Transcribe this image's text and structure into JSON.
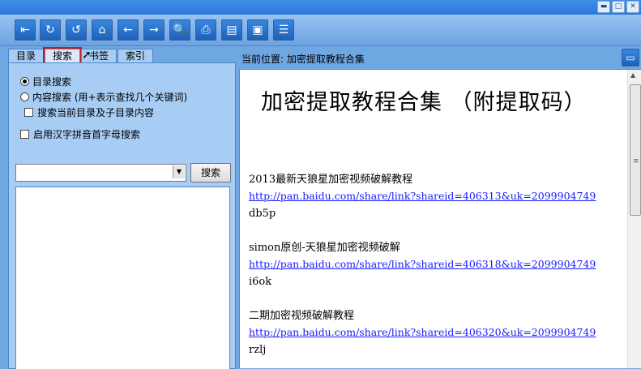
{
  "toolbar": {
    "buttons": [
      {
        "name": "hide-pane-icon",
        "glyph": "⇤"
      },
      {
        "name": "refresh-icon",
        "glyph": "↻"
      },
      {
        "name": "stop-icon",
        "glyph": "↺"
      },
      {
        "name": "home-icon",
        "glyph": "⌂"
      },
      {
        "name": "back-icon",
        "glyph": "←"
      },
      {
        "name": "forward-icon",
        "glyph": "→"
      },
      {
        "name": "locate-icon",
        "glyph": "🔍"
      },
      {
        "name": "print-icon",
        "glyph": "⎙"
      },
      {
        "name": "notes-icon",
        "glyph": "▤"
      },
      {
        "name": "options-icon",
        "glyph": "▣"
      },
      {
        "name": "help-icon",
        "glyph": "☰"
      }
    ]
  },
  "left": {
    "tabs": [
      "目录",
      "搜索",
      "书签",
      "索引"
    ],
    "active_tab": "搜索",
    "options": {
      "dir_search": "目录搜索",
      "content_search": "内容搜索 (用+表示查找几个关键词)",
      "search_current": "搜索当前目录及子目录内容",
      "pinyin_search": "启用汉字拼音首字母搜索"
    },
    "search_input_value": "",
    "search_button": "搜索"
  },
  "header": {
    "breadcrumb": "当前位置: 加密提取教程合集"
  },
  "doc": {
    "title": "加密提取教程合集   （附提取码）",
    "entries": [
      {
        "name": "2013最新天狼星加密视频破解教程",
        "url": "http://pan.baidu.com/share/link?shareid=406313&uk=2099904749",
        "code": "db5p"
      },
      {
        "name": "simon原创-天狼星加密视频破解",
        "url": "http://pan.baidu.com/share/link?shareid=406318&uk=2099904749",
        "code": "i6ok"
      },
      {
        "name": "二期加密视频破解教程",
        "url": "http://pan.baidu.com/share/link?shareid=406320&uk=2099904749",
        "code": "rzlj"
      }
    ]
  }
}
